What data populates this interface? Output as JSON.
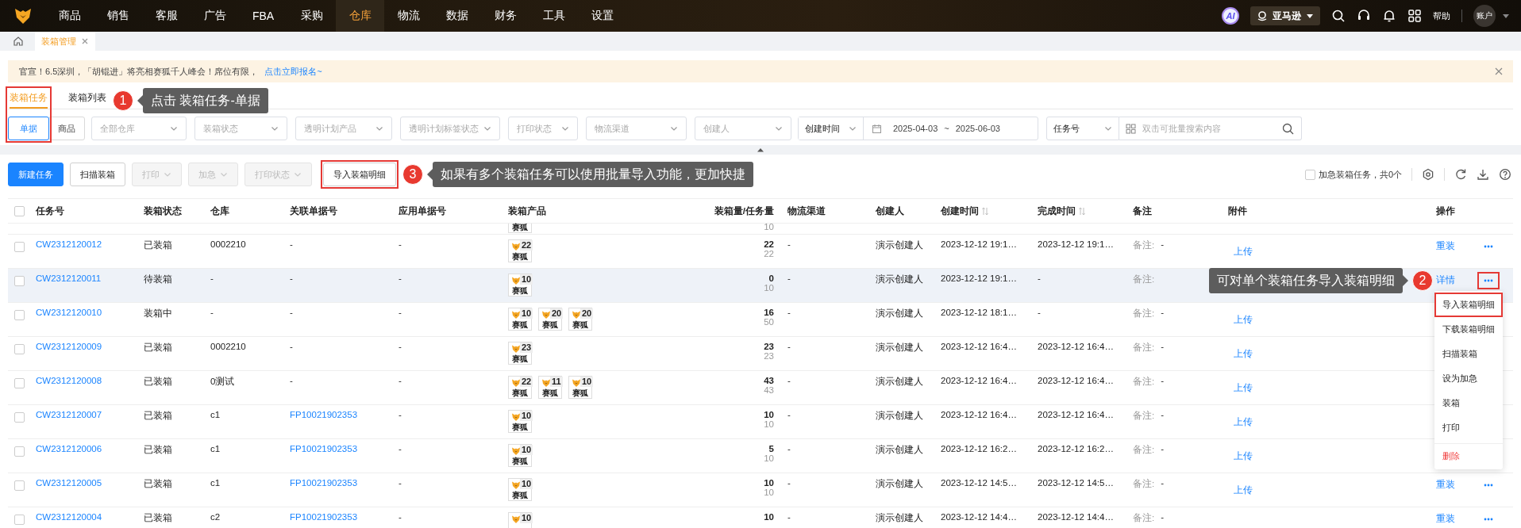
{
  "nav": {
    "items": [
      {
        "label": "商品",
        "selected": false
      },
      {
        "label": "销售",
        "selected": false
      },
      {
        "label": "客服",
        "selected": false
      },
      {
        "label": "广告",
        "selected": false
      },
      {
        "label": "FBA",
        "selected": false
      },
      {
        "label": "采购",
        "selected": false
      },
      {
        "label": "仓库",
        "selected": true
      },
      {
        "label": "物流",
        "selected": false
      },
      {
        "label": "数据",
        "selected": false
      },
      {
        "label": "财务",
        "selected": false
      },
      {
        "label": "工具",
        "selected": false
      },
      {
        "label": "设置",
        "selected": false
      }
    ],
    "ai_badge": "AI",
    "marketplace": "亚马逊",
    "help": "帮助",
    "account": "账户"
  },
  "tabs": [
    {
      "label": "装箱管理",
      "selected": true
    }
  ],
  "notice": {
    "text": "官宣！6.5深圳，「胡锟进」将亮相赛狐千人峰会！席位有限，",
    "link": "点击立即报名~"
  },
  "sub_tabs": [
    {
      "label": "装箱任务",
      "selected": true
    },
    {
      "label": "装箱列表",
      "selected": false
    }
  ],
  "filters": {
    "mode": [
      {
        "label": "单据",
        "selected": true
      },
      {
        "label": "商品",
        "selected": false
      }
    ],
    "selects": [
      {
        "placeholder": "全部仓库"
      },
      {
        "placeholder": "装箱状态"
      },
      {
        "placeholder": "透明计划产品"
      },
      {
        "placeholder": "透明计划标签状态"
      },
      {
        "placeholder": "打印状态"
      },
      {
        "placeholder": "物流渠道"
      },
      {
        "placeholder": "创建人"
      }
    ],
    "date": {
      "field": "创建时间",
      "start": "2025-04-03",
      "separator": "~",
      "end": "2025-06-03"
    },
    "search": {
      "field": "任务号",
      "placeholder": "双击可批量搜索内容"
    }
  },
  "toolbar": {
    "buttons": [
      {
        "label": "新建任务",
        "kind": "primary",
        "disabled": false,
        "dropdown": false
      },
      {
        "label": "扫描装箱",
        "kind": "default",
        "disabled": false,
        "dropdown": false
      },
      {
        "label": "打印",
        "kind": "default",
        "disabled": true,
        "dropdown": true
      },
      {
        "label": "加急",
        "kind": "default",
        "disabled": true,
        "dropdown": true
      },
      {
        "label": "打印状态",
        "kind": "default",
        "disabled": true,
        "dropdown": true
      },
      {
        "label": "导入装箱明细",
        "kind": "import",
        "disabled": false,
        "dropdown": false
      }
    ],
    "urgent_filter": {
      "label": "加急装箱任务，共0个",
      "checked": false
    }
  },
  "table": {
    "select_all": {
      "checked": false
    },
    "columns": [
      {
        "label": "任务号"
      },
      {
        "label": "装箱状态"
      },
      {
        "label": "仓库"
      },
      {
        "label": "关联单据号"
      },
      {
        "label": "应用单据号"
      },
      {
        "label": "装箱产品"
      },
      {
        "label": "装箱量/任务量"
      },
      {
        "label": "物流渠道"
      },
      {
        "label": "创建人"
      },
      {
        "label": "创建时间",
        "sortable": true
      },
      {
        "label": "完成时间",
        "sortable": true
      },
      {
        "label": "备注"
      },
      {
        "label": "附件"
      },
      {
        "label": "操作"
      }
    ],
    "rows": [
      {
        "kind": "partial",
        "products": [
          {
            "label": "赛狐"
          }
        ],
        "total": "10"
      },
      {
        "kind": "full",
        "checked": false,
        "highlighted": false,
        "menu_open": false,
        "id": "CW2312120012",
        "status": "已装箱",
        "warehouse": "0002210",
        "linked_doc": "-",
        "linked": false,
        "applied_doc": "-",
        "products": [
          {
            "count": "22",
            "label": "赛狐"
          }
        ],
        "packed": "22",
        "total": "22",
        "channel": "-",
        "creator": "演示创建人",
        "created": "2023-12-12 19:1…",
        "finished": "2023-12-12 19:1…",
        "remark_label": "备注:",
        "remark": "-",
        "attachment": "上传",
        "actions": [
          "重装"
        ],
        "more": true
      },
      {
        "kind": "full",
        "checked": false,
        "highlighted": true,
        "menu_open": true,
        "id": "CW2312120011",
        "status": "待装箱",
        "warehouse": "-",
        "linked_doc": "-",
        "linked": false,
        "applied_doc": "-",
        "products": [
          {
            "count": "10",
            "label": "赛狐"
          }
        ],
        "packed": "0",
        "total": "10",
        "channel": "-",
        "creator": "演示创建人",
        "created": "2023-12-12 19:1…",
        "finished": "-",
        "remark_label": "备注:",
        "actions": [
          "详情"
        ],
        "more": true
      },
      {
        "kind": "full",
        "checked": false,
        "highlighted": false,
        "id": "CW2312120010",
        "status": "装箱中",
        "warehouse": "-",
        "linked_doc": "-",
        "linked": false,
        "applied_doc": "-",
        "products": [
          {
            "count": "10",
            "label": "赛狐"
          },
          {
            "count": "20",
            "label": "赛狐"
          },
          {
            "count": "20",
            "label": "赛狐"
          }
        ],
        "packed": "16",
        "total": "50",
        "channel": "-",
        "creator": "演示创建人",
        "created": "2023-12-12 18:1…",
        "finished": "-",
        "remark_label": "备注:",
        "remark": "-",
        "attachment": "上传"
      },
      {
        "kind": "full",
        "checked": false,
        "highlighted": false,
        "id": "CW2312120009",
        "status": "已装箱",
        "warehouse": "0002210",
        "linked_doc": "-",
        "linked": false,
        "applied_doc": "-",
        "products": [
          {
            "count": "23",
            "label": "赛狐"
          }
        ],
        "packed": "23",
        "total": "23",
        "channel": "-",
        "creator": "演示创建人",
        "created": "2023-12-12 16:4…",
        "finished": "2023-12-12 16:4…",
        "remark_label": "备注:",
        "remark": "-",
        "attachment": "上传"
      },
      {
        "kind": "full",
        "checked": false,
        "highlighted": false,
        "id": "CW2312120008",
        "status": "已装箱",
        "warehouse": "0测试",
        "linked_doc": "-",
        "linked": false,
        "applied_doc": "-",
        "products": [
          {
            "count": "22",
            "label": "赛狐"
          },
          {
            "count": "11",
            "label": "赛狐"
          },
          {
            "count": "10",
            "label": "赛狐"
          }
        ],
        "packed": "43",
        "total": "43",
        "channel": "-",
        "creator": "演示创建人",
        "created": "2023-12-12 16:4…",
        "finished": "2023-12-12 16:4…",
        "remark_label": "备注:",
        "remark": "-",
        "attachment": "上传"
      },
      {
        "kind": "full",
        "checked": false,
        "highlighted": false,
        "id": "CW2312120007",
        "status": "已装箱",
        "warehouse": "c1",
        "linked_doc": "FP10021902353",
        "linked": true,
        "applied_doc": "-",
        "products": [
          {
            "count": "10",
            "label": "赛狐"
          }
        ],
        "packed": "10",
        "total": "10",
        "channel": "-",
        "creator": "演示创建人",
        "created": "2023-12-12 16:4…",
        "finished": "2023-12-12 16:4…",
        "remark_label": "备注:",
        "remark": "-",
        "attachment": "上传"
      },
      {
        "kind": "full",
        "checked": false,
        "highlighted": false,
        "id": "CW2312120006",
        "status": "已装箱",
        "warehouse": "c1",
        "linked_doc": "FP10021902353",
        "linked": true,
        "applied_doc": "-",
        "products": [
          {
            "count": "10",
            "label": "赛狐"
          }
        ],
        "packed": "5",
        "total": "10",
        "channel": "-",
        "creator": "演示创建人",
        "created": "2023-12-12 16:2…",
        "finished": "2023-12-12 16:2…",
        "remark_label": "备注:",
        "remark": "-",
        "attachment": "上传"
      },
      {
        "kind": "full",
        "checked": false,
        "highlighted": false,
        "menu_open": false,
        "id": "CW2312120005",
        "status": "已装箱",
        "warehouse": "c1",
        "linked_doc": "FP10021902353",
        "linked": true,
        "applied_doc": "-",
        "products": [
          {
            "count": "10",
            "label": "赛狐"
          }
        ],
        "packed": "10",
        "total": "10",
        "channel": "-",
        "creator": "演示创建人",
        "created": "2023-12-12 14:5…",
        "finished": "2023-12-12 14:5…",
        "remark_label": "备注:",
        "remark": "-",
        "attachment": "上传",
        "actions": [
          "重装"
        ],
        "more": true
      },
      {
        "kind": "full",
        "checked": false,
        "highlighted": false,
        "menu_open": false,
        "id": "CW2312120004",
        "status": "已装箱",
        "warehouse": "c2",
        "linked_doc": "FP10021902353",
        "linked": true,
        "applied_doc": "-",
        "products": [
          {
            "count": "10"
          }
        ],
        "packed": "10",
        "channel": "-",
        "creator": "演示创建人",
        "created": "2023-12-12 14:4…",
        "finished": "2023-12-12 14:4…",
        "remark_label": "备注:",
        "remark": "-",
        "actions": [
          "重装"
        ],
        "more": true
      }
    ]
  },
  "row_menu": {
    "items": [
      {
        "label": "导入装箱明细",
        "danger": false,
        "framed": true
      },
      {
        "label": "下载装箱明细",
        "danger": false,
        "framed": false
      },
      {
        "label": "扫描装箱",
        "danger": false,
        "framed": false
      },
      {
        "label": "设为加急",
        "danger": false,
        "framed": false
      },
      {
        "label": "装箱",
        "danger": false,
        "framed": false
      },
      {
        "label": "打印",
        "danger": false,
        "framed": false
      },
      {
        "label": "删除",
        "danger": true,
        "framed": false
      }
    ]
  },
  "annotations": [
    {
      "kind": "tabs",
      "number": "1",
      "text": "点击 装箱任务-单据"
    },
    {
      "kind": "import",
      "number": "3",
      "text": "如果有多个装箱任务可以使用批量导入功能，更加快捷"
    },
    {
      "kind": "row-more",
      "number": "2",
      "text": "可对单个装箱任务导入装箱明细"
    }
  ]
}
